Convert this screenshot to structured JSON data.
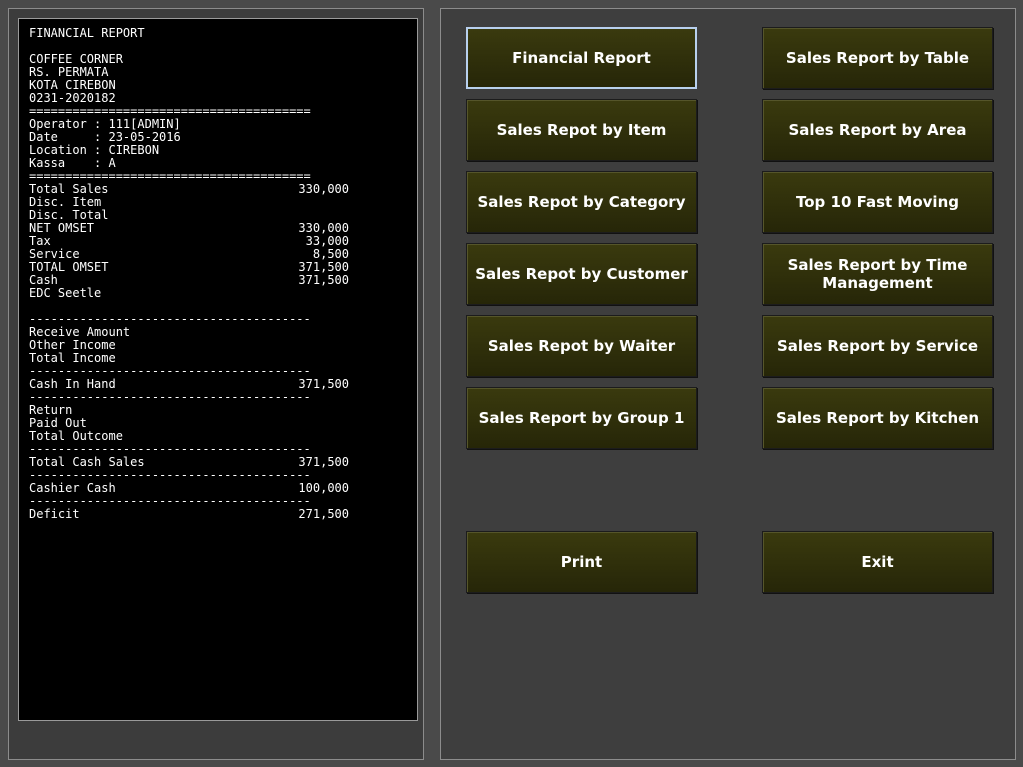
{
  "receipt": {
    "title": "FINANCIAL REPORT",
    "header": [
      "COFFEE CORNER",
      "RS. PERMATA",
      "KOTA CIREBON",
      "0231-2020182"
    ],
    "rule_double": "=======================================",
    "rule_single": "---------------------------------------",
    "info": [
      "Operator : 111[ADMIN]",
      "Date     : 23-05-2016",
      "Location : CIREBON",
      "Kassa    : A"
    ],
    "sales": [
      {
        "label": "Total Sales",
        "amount": "330,000"
      },
      {
        "label": "Disc. Item",
        "amount": ""
      },
      {
        "label": "Disc. Total",
        "amount": ""
      },
      {
        "label": "NET OMSET",
        "amount": "330,000"
      },
      {
        "label": "Tax",
        "amount": "33,000"
      },
      {
        "label": "Service",
        "amount": "8,500"
      },
      {
        "label": "TOTAL OMSET",
        "amount": "371,500"
      },
      {
        "label": "Cash",
        "amount": "371,500"
      },
      {
        "label": "EDC Seetle",
        "amount": ""
      }
    ],
    "income": [
      {
        "label": "Receive Amount",
        "amount": ""
      },
      {
        "label": "Other Income",
        "amount": ""
      },
      {
        "label": "Total Income",
        "amount": ""
      }
    ],
    "cash_in_hand": {
      "label": "Cash In Hand",
      "amount": "371,500"
    },
    "outcome": [
      {
        "label": "Return",
        "amount": ""
      },
      {
        "label": "Paid Out",
        "amount": ""
      },
      {
        "label": "Total Outcome",
        "amount": ""
      }
    ],
    "total_cash_sales": {
      "label": "Total Cash Sales",
      "amount": "371,500"
    },
    "cashier_cash": {
      "label": "Cashier Cash",
      "amount": "100,000"
    },
    "deficit": {
      "label": "Deficit",
      "amount": "271,500"
    }
  },
  "buttons": {
    "financial_report": "Financial Report",
    "sales_by_table": "Sales Report by Table",
    "sales_by_item": "Sales Repot by Item",
    "sales_by_area": "Sales Report by Area",
    "sales_by_category": "Sales Repot by Category",
    "top10_fast_moving": "Top 10 Fast Moving",
    "sales_by_customer": "Sales Repot by Customer",
    "sales_by_time_1": "Sales Report by Time",
    "sales_by_time_2": "Management",
    "sales_by_waiter": "Sales Repot by Waiter",
    "sales_by_service": "Sales Report by Service",
    "sales_by_group1": "Sales Report by Group 1",
    "sales_by_kitchen": "Sales Report by Kitchen",
    "print": "Print",
    "exit": "Exit"
  }
}
